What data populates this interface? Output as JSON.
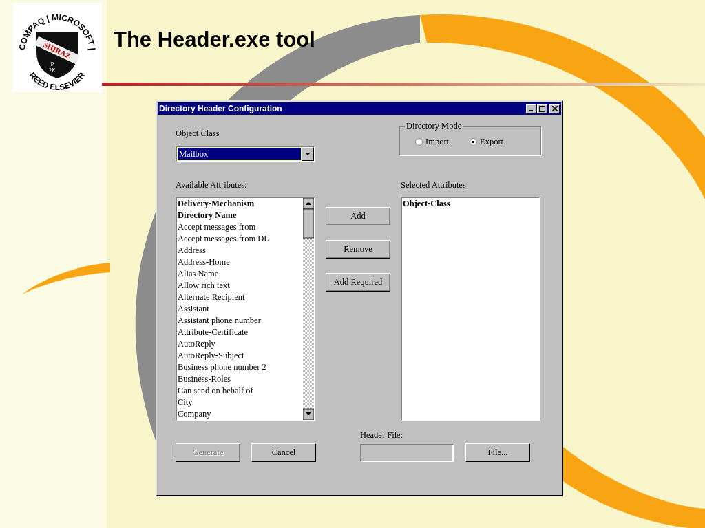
{
  "slide": {
    "title": "The Header.exe tool",
    "logo": {
      "ring_top": "COMPAQ | MICROSOFT |",
      "band": "SHIRAZ",
      "mark_top": "P",
      "mark_bottom": "2K",
      "ring_bottom": "REED ELSEVIER"
    }
  },
  "window": {
    "title": "Directory Header Configuration",
    "object_class": {
      "label": "Object Class",
      "value": "Mailbox"
    },
    "directory_mode": {
      "label": "Directory Mode",
      "options": [
        {
          "label": "Import",
          "selected": false
        },
        {
          "label": "Export",
          "selected": true
        }
      ]
    },
    "available_attributes": {
      "label": "Available Attributes:",
      "items": [
        {
          "text": "Delivery-Mechanism",
          "bold": true
        },
        {
          "text": "Directory Name",
          "bold": true
        },
        {
          "text": "Accept messages from",
          "bold": false
        },
        {
          "text": "Accept messages from DL",
          "bold": false
        },
        {
          "text": "Address",
          "bold": false
        },
        {
          "text": "Address-Home",
          "bold": false
        },
        {
          "text": "Alias Name",
          "bold": false
        },
        {
          "text": "Allow rich text",
          "bold": false
        },
        {
          "text": "Alternate Recipient",
          "bold": false
        },
        {
          "text": "Assistant",
          "bold": false
        },
        {
          "text": "Assistant phone number",
          "bold": false
        },
        {
          "text": "Attribute-Certificate",
          "bold": false
        },
        {
          "text": "AutoReply",
          "bold": false
        },
        {
          "text": "AutoReply-Subject",
          "bold": false
        },
        {
          "text": "Business phone number 2",
          "bold": false
        },
        {
          "text": "Business-Roles",
          "bold": false
        },
        {
          "text": "Can send on behalf of",
          "bold": false
        },
        {
          "text": "City",
          "bold": false
        },
        {
          "text": "Company",
          "bold": false
        }
      ]
    },
    "middle_buttons": [
      {
        "label": "Add",
        "disabled": false
      },
      {
        "label": "Remove",
        "disabled": false
      },
      {
        "label": "Add Required",
        "disabled": false
      }
    ],
    "selected_attributes": {
      "label": "Selected Attributes:",
      "items": [
        {
          "text": "Object-Class",
          "bold": true
        }
      ]
    },
    "bottom_buttons": [
      {
        "label": "Generate",
        "disabled": true
      },
      {
        "label": "Cancel",
        "disabled": false
      }
    ],
    "header_file": {
      "label": "Header File:"
    },
    "file_button": {
      "label": "File...",
      "disabled": false
    }
  }
}
